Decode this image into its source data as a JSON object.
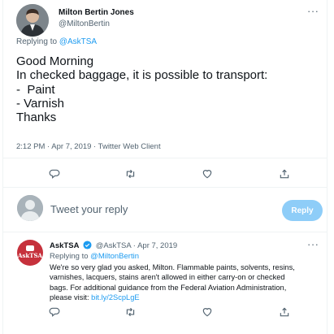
{
  "original_tweet": {
    "author": {
      "display_name": "Milton Bertin Jones",
      "handle": "@MiltonBertin"
    },
    "more_label": "···",
    "replying_prefix": "Replying to",
    "replying_to": "@AskTSA",
    "text_lines": [
      "Good Morning",
      "In checked baggage, it is possible to transport:",
      "-  Paint",
      "- Varnish",
      "Thanks"
    ],
    "meta": "2:12 PM · Apr 7, 2019 · Twitter Web Client"
  },
  "actions": {
    "icons": [
      "reply-icon",
      "retweet-icon",
      "like-icon",
      "share-icon"
    ]
  },
  "composer": {
    "placeholder": "Tweet your reply",
    "reply_label": "Reply"
  },
  "reply_tweet": {
    "avatar_text": "AskTSA",
    "display_name": "AskTSA",
    "handle_time": "@AskTSA · Apr 7, 2019",
    "more_label": "···",
    "replying_prefix": "Replying to",
    "replying_to": "@MiltonBertin",
    "body_lines": [
      "We're so very glad you asked, Milton. Flammable paints, solvents, resins,",
      "varnishes, lacquers, stains aren't allowed in either carry-on or checked",
      "bags. For additional guidance from the Federal Aviation Administration,"
    ],
    "body_last_prefix": "please visit:",
    "body_link": "bit.ly/2ScpLgE"
  },
  "colors": {
    "link": "#1d9bf0",
    "secondary_text": "#536471",
    "reply_button_disabled": "#8ecdf8",
    "tsa_brand": "#c6313c"
  }
}
